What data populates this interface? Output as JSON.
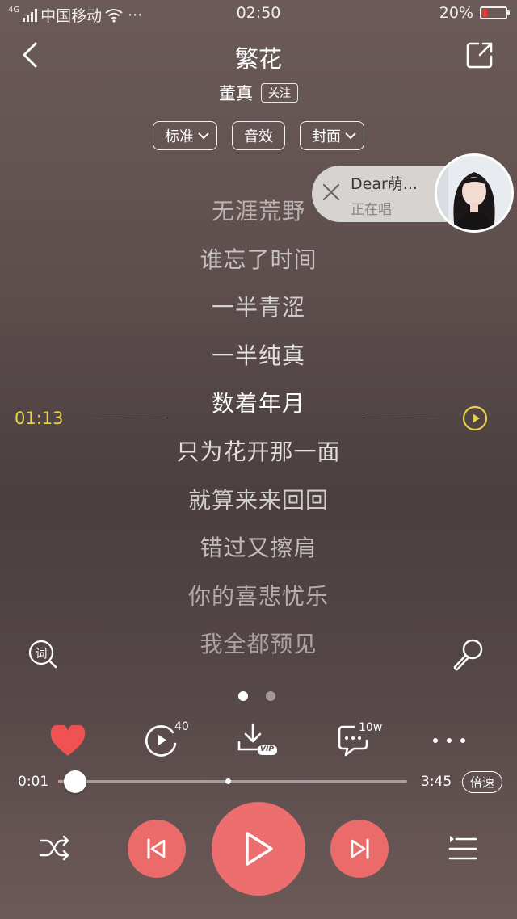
{
  "status_bar": {
    "network": "4G",
    "carrier": "中国移动",
    "dots": "···",
    "time": "02:50",
    "battery": "20%",
    "battery_level": 0.2,
    "battery_color": "#e53935"
  },
  "header": {
    "title": "繁花",
    "artist": "董真",
    "follow_label": "关注",
    "options": [
      "标准",
      "音效",
      "封面"
    ]
  },
  "singing": {
    "name": "Dear萌...",
    "status": "正在唱"
  },
  "lyrics": {
    "current_time": "01:13",
    "lines": [
      "无涯荒野",
      "谁忘了时间",
      "一半青涩",
      "一半纯真",
      "数着年月",
      "只为花开那一面",
      "就算来来回回",
      "错过又擦肩",
      "你的喜悲忧乐",
      "我全都预见"
    ],
    "current_index": 4,
    "lyric_icon_text": "词"
  },
  "actions": {
    "video_count": "40",
    "vip_label": "VIP",
    "comment_count": "10w",
    "liked": true
  },
  "progress": {
    "elapsed": "0:01",
    "total": "3:45",
    "fraction": 0.004,
    "speed_label": "倍速"
  },
  "colors": {
    "accent": "#eb6b6b",
    "current_time": "#e6d24b",
    "heart": "#f05252"
  }
}
